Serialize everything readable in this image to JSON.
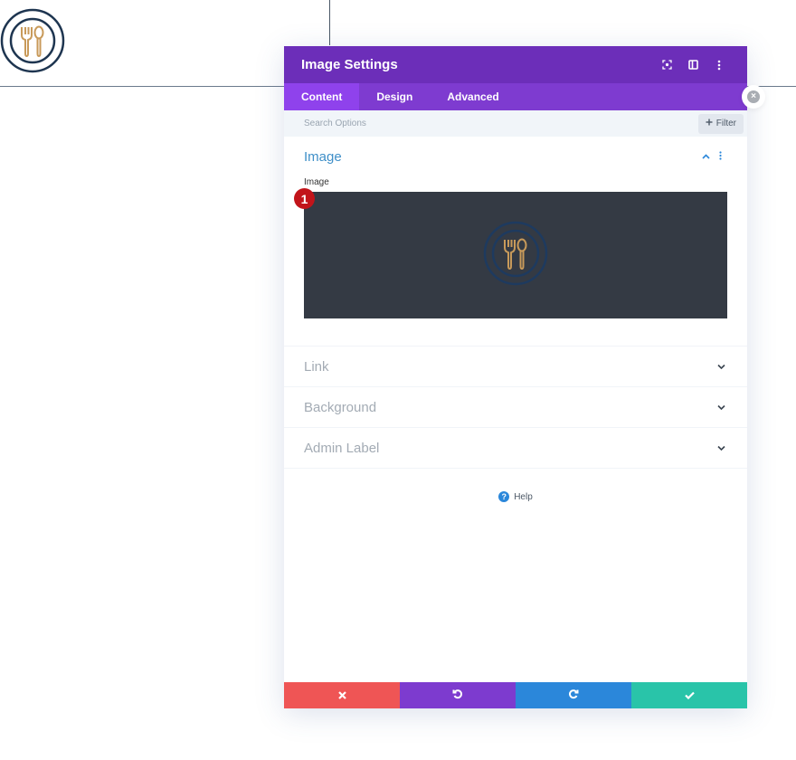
{
  "canvas": {
    "logo_icon": "plate-fork-spoon-icon"
  },
  "modal": {
    "title": "Image Settings",
    "header_icons": [
      "focus-icon",
      "split-view-icon",
      "more-vertical-icon"
    ],
    "tabs": [
      {
        "label": "Content",
        "active": true
      },
      {
        "label": "Design",
        "active": false
      },
      {
        "label": "Advanced",
        "active": false
      }
    ],
    "search": {
      "placeholder": "Search Options",
      "value": ""
    },
    "filter_label": "Filter",
    "sections": {
      "image": {
        "title": "Image",
        "field_label": "Image",
        "badge": "1",
        "preview_icon": "plate-fork-spoon-icon"
      },
      "collapsed": [
        {
          "title": "Link"
        },
        {
          "title": "Background"
        },
        {
          "title": "Admin Label"
        }
      ]
    },
    "help_label": "Help",
    "footer": {
      "cancel_icon": "close-icon",
      "undo_icon": "undo-icon",
      "redo_icon": "redo-icon",
      "save_icon": "check-icon"
    }
  },
  "colors": {
    "header": "#6c2eb9",
    "tabs": "#7e3bd0",
    "tab_active": "#8f42ec",
    "accent_blue": "#2b87da",
    "cancel": "#ef5555",
    "undo": "#7d3bcf",
    "redo": "#2b87da",
    "save": "#29c4a9",
    "badge": "#c2141a",
    "icon_gold": "#c89a5a",
    "icon_navy": "#1e3550"
  }
}
